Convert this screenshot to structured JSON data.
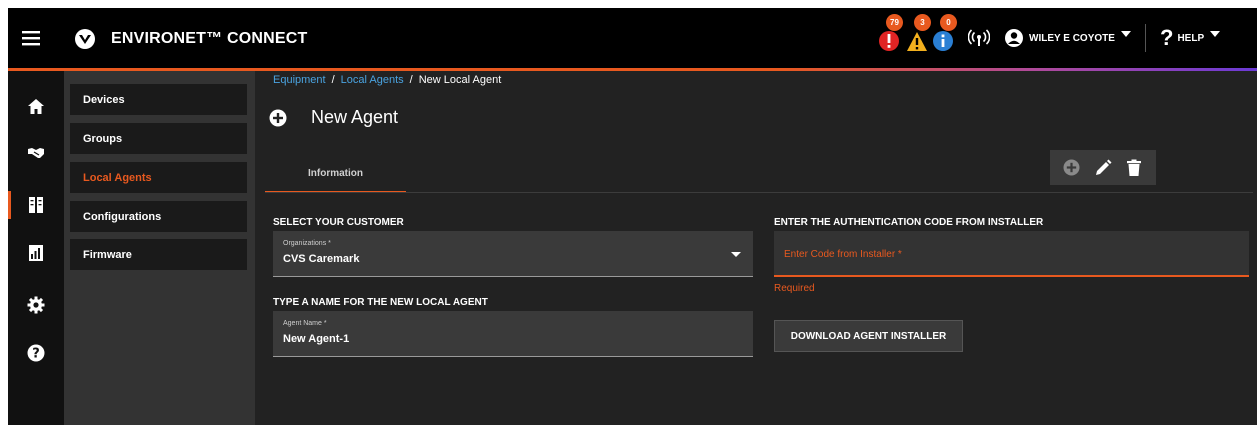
{
  "header": {
    "app_title": "ENVIRONET™ CONNECT",
    "alerts": {
      "critical_count": "79",
      "warning_count": "3",
      "info_count": "0"
    },
    "user_name": "WILEY E COYOTE",
    "help_label": "HELP"
  },
  "rail": {
    "items": [
      "home-icon",
      "handshake-icon",
      "equipment-icon",
      "reports-icon",
      "settings-icon",
      "help-icon"
    ],
    "active": "equipment-icon"
  },
  "subnav": {
    "items": [
      {
        "label": "Devices"
      },
      {
        "label": "Groups"
      },
      {
        "label": "Local Agents"
      },
      {
        "label": "Configurations"
      },
      {
        "label": "Firmware"
      }
    ],
    "active_index": 2
  },
  "breadcrumb": {
    "items": [
      "Equipment",
      "Local Agents",
      "New Local Agent"
    ],
    "separator": "/"
  },
  "page": {
    "title": "New Agent",
    "tab_label": "Information"
  },
  "form": {
    "customer_section_label": "SELECT YOUR CUSTOMER",
    "organization": {
      "label": "Organizations *",
      "value": "CVS Caremark"
    },
    "agent_section_label": "TYPE A NAME FOR THE NEW LOCAL AGENT",
    "agent_name": {
      "label": "Agent Name *",
      "value": "New Agent-1"
    },
    "auth_section_label": "ENTER THE AUTHENTICATION CODE FROM INSTALLER",
    "auth_code": {
      "placeholder": "Enter Code from Installer *",
      "error": "Required"
    },
    "download_button_label": "DOWNLOAD AGENT INSTALLER"
  },
  "colors": {
    "accent": "#e8591f",
    "link": "#4aa3e0",
    "warning": "#f2b01e",
    "info": "#2a7fd4",
    "critical": "#e02424"
  }
}
